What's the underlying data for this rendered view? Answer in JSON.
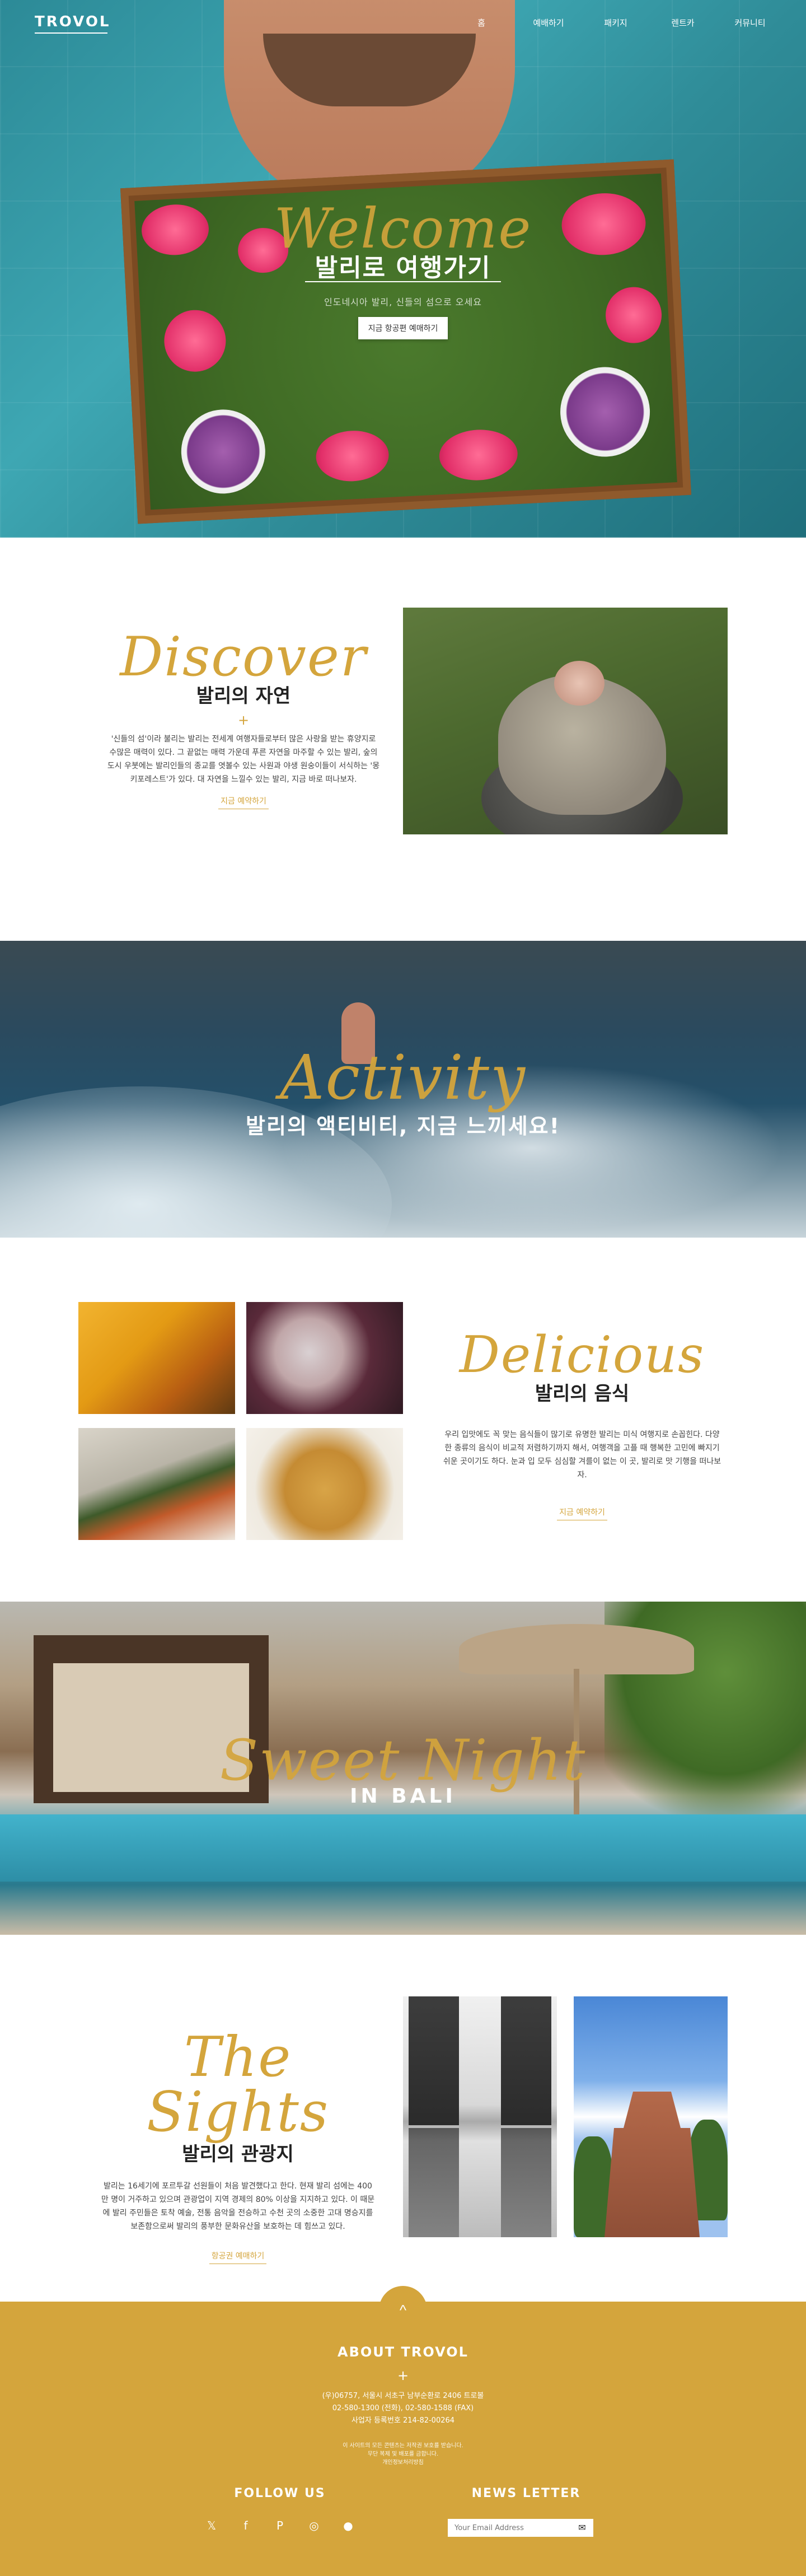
{
  "nav": {
    "logo": "TROVOL",
    "links": [
      "홈",
      "예배하기",
      "패키지",
      "렌트카",
      "커뮤니티"
    ]
  },
  "hero": {
    "script_title": "Welcome",
    "title": "발리로 여행가기",
    "subtitle": "인도네시아 발리, 신들의 섬으로 오세요",
    "button": "지금 항공편 예매하기"
  },
  "discover": {
    "script_title": "Discover",
    "title": "발리의 자연",
    "plus": "+",
    "body": "'신들의 섬'이라 불리는 발리는 전세계 여행자들로부터 많은 사랑을 받는 휴양지로 수많은 매력이 있다. 그 끝없는 매력 가운데 푸른 자연을 마주할 수 있는 발리, 숲의 도시 우붓에는 발리인들의 종교를 엿볼수 있는 사원과 야생 원숭이들이 서식하는 '몽키포레스트'가 있다. 대 자연을 느낄수 있는 발리, 지금 바로 떠나보자.",
    "link": "지금 예약하기"
  },
  "activity": {
    "script_title": "Activity",
    "title": "발리의 액티비티, 지금 느끼세요!"
  },
  "delicious": {
    "script_title": "Delicious",
    "title": "발리의 음식",
    "body": "우리 입맛에도 꼭 맞는 음식들이 많기로 유명한 발리는 미식 여행지로 손꼽힌다. 다양한 종류의 음식이 비교적 저렴하기까지 해서, 여행객을 고플 때 행복한 고민에 빠지기 쉬운 곳이기도 하다. 눈과 입 모두 심심할 겨를이 없는 이 곳, 발리로 맛 기행을 떠나보자.",
    "link": "지금 예약하기"
  },
  "night": {
    "script_title": "Sweet Night",
    "title": "IN BALI"
  },
  "sights": {
    "script_title": "The Sights",
    "title": "발리의 관광지",
    "body": "발리는 16세기에 포르투갈 선원들이 처음 발견했다고 한다. 현재 발리 섬에는 400만 명이 거주하고 있으며 관광업이 지역 경제의 80% 이상을 지지하고 있다. 이 때문에 발리 주민들은 토착 예술, 전통 음악을 전승하고 수천 곳의 소중한 고대 명승지를 보존함으로써 발리의 풍부한 문화유산을 보호하는 데 힘쓰고 있다.",
    "link": "항공권 예매하기"
  },
  "footer": {
    "up_icon": "^",
    "about_title": "ABOUT TROVOL",
    "plus": "+",
    "address": "(우)06757, 서울시 서초구 남부순환로 2406 트로볼",
    "phone": "02-580-1300 (전화), 02-580-1588 (FAX)",
    "biz_no": "사업자 등록번호 214-82-00264",
    "small_1": "이 사이트의 모든 콘텐츠는 저작권 보호를 받습니다.",
    "small_2": "무단 복제 및 배포를 금합니다.",
    "small_3": "개인정보처리방침",
    "follow_title": "FOLLOW US",
    "socials": [
      "twitter-icon",
      "facebook-icon",
      "pinterest-icon",
      "instagram-icon",
      "discord-icon"
    ],
    "social_glyphs": [
      "𝕏",
      "f",
      "P",
      "◎",
      "●"
    ],
    "newsletter_title": "NEWS LETTER",
    "newsletter_placeholder": "Your Email Address",
    "send_icon": "✉"
  },
  "colors": {
    "accent": "#d4a53c",
    "white": "#ffffff"
  }
}
